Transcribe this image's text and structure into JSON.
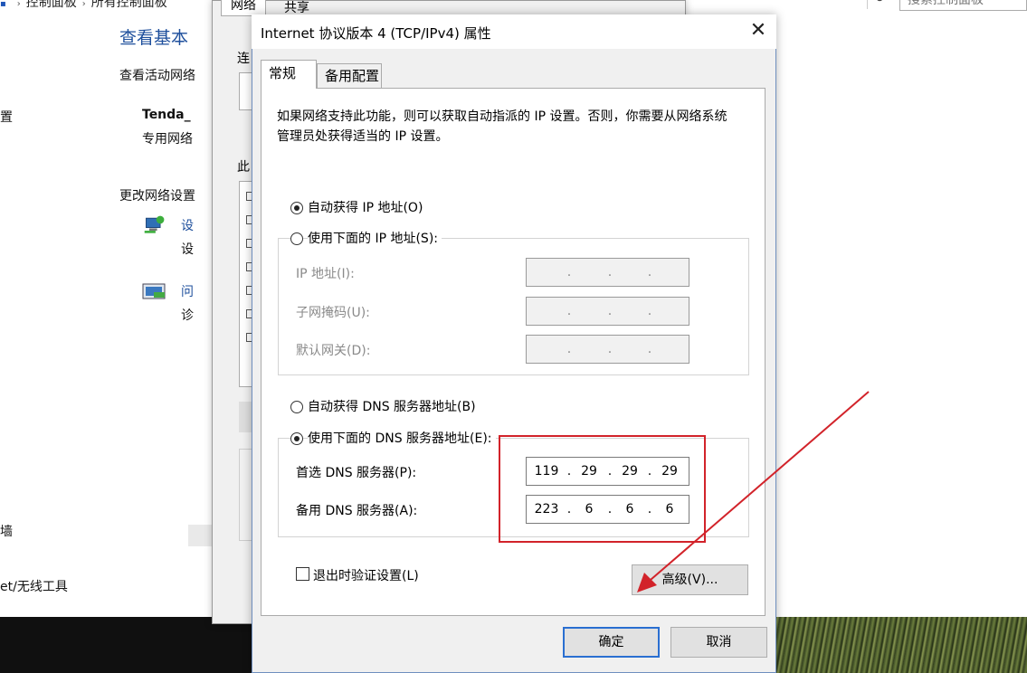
{
  "background": {
    "breadcrumb": [
      "控制面板",
      "所有控制面板"
    ],
    "search_placeholder": "搜索控制面板",
    "page_title": "查看基本",
    "active_network_heading": "查看活动网络",
    "network_name": "Tenda_",
    "network_type": "专用网络",
    "change_settings_heading": "更改网络设置",
    "item1_line1": "设",
    "item1_line2": "设",
    "item2_line1": "问",
    "item2_line2": "诊",
    "left_fragment_1": "置",
    "left_fragment_2": "墙",
    "left_fragment_3": "et/无线工具",
    "behind_tabs": [
      "网络",
      "共享"
    ],
    "behind_side_1": "连",
    "behind_side_2": "此"
  },
  "dialog": {
    "title": "Internet 协议版本 4 (TCP/IPv4) 属性",
    "tabs": [
      {
        "label": "常规",
        "active": true
      },
      {
        "label": "备用配置",
        "active": false
      }
    ],
    "description": "如果网络支持此功能，则可以获取自动指派的 IP 设置。否则，你需要从网络系统管理员处获得适当的 IP 设置。",
    "ip_mode": {
      "auto_label": "自动获得 IP 地址(O)",
      "manual_label": "使用下面的 IP 地址(S):",
      "selected": "auto"
    },
    "ip_fields": [
      {
        "label": "IP 地址(I):",
        "octets": [
          "",
          "",
          "",
          ""
        ]
      },
      {
        "label": "子网掩码(U):",
        "octets": [
          "",
          "",
          "",
          ""
        ]
      },
      {
        "label": "默认网关(D):",
        "octets": [
          "",
          "",
          "",
          ""
        ]
      }
    ],
    "dns_mode": {
      "auto_label": "自动获得 DNS 服务器地址(B)",
      "manual_label": "使用下面的 DNS 服务器地址(E):",
      "selected": "manual"
    },
    "dns_fields": [
      {
        "label": "首选 DNS 服务器(P):",
        "octets": [
          "119",
          "29",
          "29",
          "29"
        ]
      },
      {
        "label": "备用 DNS 服务器(A):",
        "octets": [
          "223",
          "6",
          "6",
          "6"
        ]
      }
    ],
    "validate_on_exit_label": "退出时验证设置(L)",
    "validate_on_exit": false,
    "advanced_button": "高级(V)...",
    "ok_button": "确定",
    "cancel_button": "取消"
  },
  "annotation_colors": {
    "highlight": "#d2232a"
  }
}
